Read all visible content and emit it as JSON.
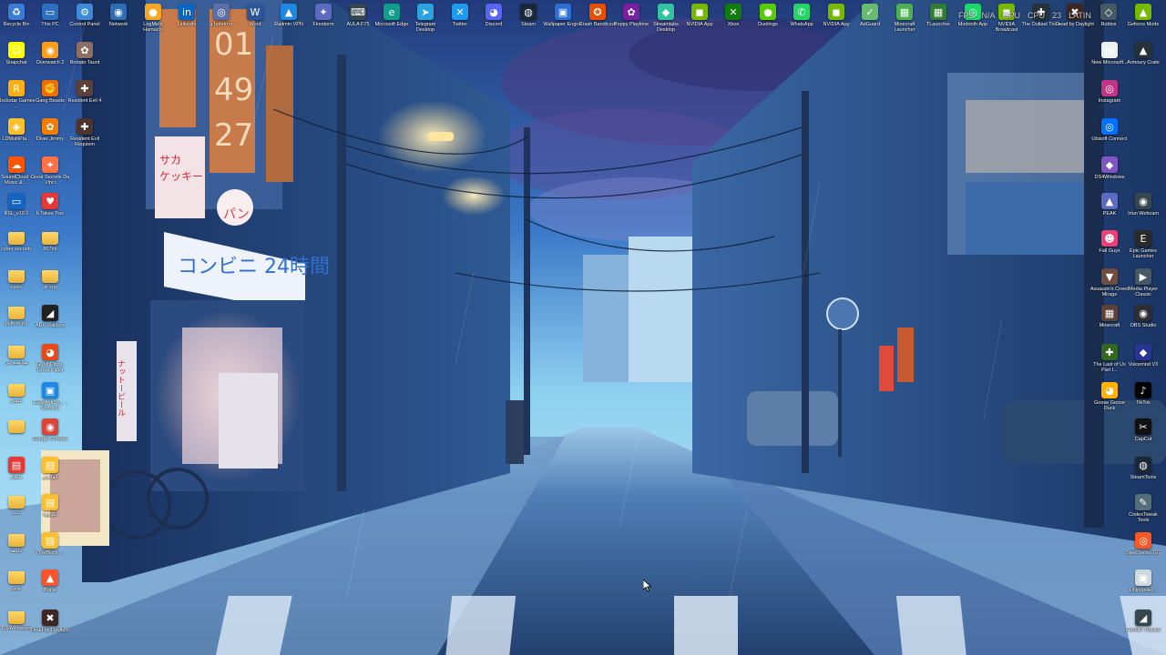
{
  "overlay": {
    "fps": "FPS",
    "gpu": "N/A",
    "gpu_label": "GPU",
    "cpu_label": "CPU",
    "cpu_value": "23",
    "brand": "LATIN"
  },
  "wallpaper": {
    "window_digits": [
      "01",
      "49",
      "27"
    ],
    "store_sign_katakana": "サカ ケッキー",
    "store_sign_main": "コンビニ 24時間",
    "store_sign_pan": "パン",
    "vertical_banner": "ナットーピール"
  },
  "colors": {
    "sky": "#1b3a78",
    "street": "#3c5f95",
    "lamp": "#ffd98a"
  },
  "icons": [
    {
      "name": "recycle-bin",
      "label": "Recycle Bin",
      "glyph": "♻",
      "color": "#3a7bd5",
      "folder": false
    },
    {
      "name": "this-pc",
      "label": "This PC",
      "glyph": "▭",
      "color": "#2f6fbf",
      "folder": false
    },
    {
      "name": "control-panel",
      "label": "Control Panel",
      "glyph": "⚙",
      "color": "#3f8ad8",
      "folder": false
    },
    {
      "name": "network",
      "label": "Network",
      "glyph": "◉",
      "color": "#2e6db3",
      "folder": false
    },
    {
      "name": "logmein-hamachi",
      "label": "LogMeIn Hamachi",
      "glyph": "●",
      "color": "#f5a623",
      "folder": false
    },
    {
      "name": "linkedin",
      "label": "LinkedIn",
      "glyph": "in",
      "color": "#0a66c2",
      "folder": false
    },
    {
      "name": "gdphorror",
      "label": "g.hohorror",
      "glyph": "◎",
      "color": "#5b6ea8",
      "folder": false
    },
    {
      "name": "word",
      "label": "Word",
      "glyph": "W",
      "color": "#2b579a",
      "folder": false
    },
    {
      "name": "radmin-vpn",
      "label": "Radmin VPN",
      "glyph": "▲",
      "color": "#1e88e5",
      "folder": false
    },
    {
      "name": "firestorm",
      "label": "Firestorm",
      "glyph": "✦",
      "color": "#5c6bc0",
      "folder": false
    },
    {
      "name": "aula-f75",
      "label": "AULA F75",
      "glyph": "⌨",
      "color": "#37474f",
      "folder": false
    },
    {
      "name": "microsoft-edge",
      "label": "Microsoft Edge",
      "glyph": "e",
      "color": "#0f9d8c",
      "folder": false
    },
    {
      "name": "telegram-desktop",
      "label": "Telegram Desktop",
      "glyph": "➤",
      "color": "#2aa3df",
      "folder": false
    },
    {
      "name": "twitter",
      "label": "Twitter",
      "glyph": "✕",
      "color": "#1d9bf0",
      "folder": false
    },
    {
      "name": "discord",
      "label": "Discord",
      "glyph": "◕",
      "color": "#5865f2",
      "folder": false
    },
    {
      "name": "steam",
      "label": "Steam",
      "glyph": "◍",
      "color": "#1b2838",
      "folder": false
    },
    {
      "name": "wallpaper-engine",
      "label": "Wallpaper Engine",
      "glyph": "▣",
      "color": "#2c6fd6",
      "folder": false
    },
    {
      "name": "crash-bandicoot",
      "label": "Crash Bandicoot",
      "glyph": "✪",
      "color": "#e65100",
      "folder": false
    },
    {
      "name": "poppy-playtime",
      "label": "Poppy Playtime",
      "glyph": "✿",
      "color": "#7b1fa2",
      "folder": false
    },
    {
      "name": "streamlabs-desktop",
      "label": "Streamlabs Desktop",
      "glyph": "◆",
      "color": "#31c3a2",
      "folder": false
    },
    {
      "name": "nvidia-app",
      "label": "NVIDIA App",
      "glyph": "◼",
      "color": "#76b900",
      "folder": false
    },
    {
      "name": "xbox",
      "label": "Xbox",
      "glyph": "✕",
      "color": "#107c10",
      "folder": false
    },
    {
      "name": "duolingo",
      "label": "Duolingo",
      "glyph": "●",
      "color": "#58cc02",
      "folder": false
    },
    {
      "name": "whatsapp",
      "label": "WhatsApp",
      "glyph": "✆",
      "color": "#25d366",
      "folder": false
    },
    {
      "name": "nvidia-app-2",
      "label": "NVIDIA App",
      "glyph": "◼",
      "color": "#76b900",
      "folder": false
    },
    {
      "name": "adguard",
      "label": "AdGuard",
      "glyph": "✓",
      "color": "#68bc71",
      "folder": false
    },
    {
      "name": "minecraft-launcher",
      "label": "Minecraft Launcher",
      "glyph": "▦",
      "color": "#4caf50",
      "folder": false
    },
    {
      "name": "tlauncher",
      "label": "TLauncher",
      "glyph": "▦",
      "color": "#2e7d32",
      "folder": false
    },
    {
      "name": "modrinth-app",
      "label": "Modrinth App",
      "glyph": "◎",
      "color": "#1bd96a",
      "folder": false
    },
    {
      "name": "nvidia-broadcast",
      "label": "NVIDIA Broadcast",
      "glyph": "◼",
      "color": "#76b900",
      "folder": false
    },
    {
      "name": "the-outlast-trials",
      "label": "The Outlast Trials",
      "glyph": "✚",
      "color": "#263238",
      "folder": false
    },
    {
      "name": "dead-by-daylight-top",
      "label": "Dead by Daylight",
      "glyph": "✖",
      "color": "#3e2723",
      "folder": false
    },
    {
      "name": "roblox",
      "label": "Roblox",
      "glyph": "◇",
      "color": "#455a64",
      "folder": false
    },
    {
      "name": "geforce-mode",
      "label": "Geforce Mode",
      "glyph": "▲",
      "color": "#76b900",
      "folder": false
    },
    {
      "name": "snapchat",
      "label": "Snapchat",
      "glyph": "☺",
      "color": "#fffc00",
      "folder": false
    },
    {
      "name": "overwatch-2",
      "label": "Overwatch 2",
      "glyph": "◉",
      "color": "#f99e1a",
      "folder": false
    },
    {
      "name": "brotato",
      "label": "Brotato Taunt",
      "glyph": "✿",
      "color": "#8d6e63",
      "folder": false
    },
    {
      "name": "rockstar-games",
      "label": "Rockstar Games ...",
      "glyph": "R",
      "color": "#fcaf17",
      "folder": false
    },
    {
      "name": "gang-beasts",
      "label": "Gang Beasts",
      "glyph": "✊",
      "color": "#ef6c00",
      "folder": false
    },
    {
      "name": "resident-evil-4",
      "label": "Resident Evil 4",
      "glyph": "✚",
      "color": "#5d4037",
      "folder": false
    },
    {
      "name": "ldmultiplayer",
      "label": "LDMultiPla...",
      "glyph": "◈",
      "color": "#fbc02d",
      "folder": false
    },
    {
      "name": "diver-jimmy",
      "label": "Diver Jimmy",
      "glyph": "✿",
      "color": "#f57c00",
      "folder": false
    },
    {
      "name": "resident-evil-requiem",
      "label": "Resident Evil Requiem",
      "glyph": "✚",
      "color": "#4e342e",
      "folder": false
    },
    {
      "name": "soundcloud",
      "label": "SoundCloud - Music & ...",
      "glyph": "☁",
      "color": "#ff5500",
      "folder": false
    },
    {
      "name": "great-secrets",
      "label": "Great Secrets Da Vinci",
      "glyph": "✦",
      "color": "#ff7043",
      "folder": false
    },
    {
      "name": "bsl",
      "label": "BSL_v10.0",
      "glyph": "▭",
      "color": "#1565c0",
      "folder": false
    },
    {
      "name": "it-takes-two",
      "label": "It Takes Two",
      "glyph": "♥",
      "color": "#e53935",
      "folder": false
    },
    {
      "name": "cyber-security",
      "label": "cyber security",
      "glyph": "",
      "color": "#e8b23a",
      "folder": true
    },
    {
      "name": "folder-867hb",
      "label": "867hb",
      "glyph": "",
      "color": "#e8b23a",
      "folder": true
    },
    {
      "name": "folder-episo",
      "label": "episo",
      "glyph": "",
      "color": "#e8b23a",
      "folder": true
    },
    {
      "name": "folder-allsog",
      "label": "all sog",
      "glyph": "",
      "color": "#e8b23a",
      "folder": true
    },
    {
      "name": "python-try",
      "label": "python try",
      "glyph": "",
      "color": "#e8b23a",
      "folder": true
    },
    {
      "name": "arc-raiders",
      "label": "ARC Raiders",
      "glyph": "◢",
      "color": "#212121",
      "folder": false
    },
    {
      "name": "folder-arabic-1",
      "label": "مواضيع ابي",
      "glyph": "",
      "color": "#e8b23a",
      "folder": true
    },
    {
      "name": "good-pizza",
      "label": "Good Pizza, Great Pizza",
      "glyph": "◕",
      "color": "#e64a19",
      "folder": false
    },
    {
      "name": "folder-arabic-2",
      "label": "علوان",
      "glyph": "",
      "color": "#e8b23a",
      "folder": true
    },
    {
      "name": "easyantichaet",
      "label": "EasyAntiCh... - Shortcut",
      "glyph": "▣",
      "color": "#1e88e5",
      "folder": false
    },
    {
      "name": "folder-blank",
      "label": "",
      "glyph": "",
      "color": "#e8b23a",
      "folder": true
    },
    {
      "name": "google-chrome",
      "label": "Google Chrome",
      "glyph": "◉",
      "color": "#db4437",
      "folder": false
    },
    {
      "name": "arabic-file-1",
      "label": "دانيال",
      "glyph": "▤",
      "color": "#e53935",
      "folder": false
    },
    {
      "name": "file-alfaris",
      "label": "الفارس",
      "glyph": "▤",
      "color": "#fbc02d",
      "folder": false
    },
    {
      "name": "folder-arabic-3",
      "label": "كتب",
      "glyph": "",
      "color": "#e8b23a",
      "folder": true
    },
    {
      "name": "file-albroza",
      "label": "البروزة",
      "glyph": "▤",
      "color": "#fbc02d",
      "folder": false
    },
    {
      "name": "folder-arabic-4",
      "label": "جامعة",
      "glyph": "",
      "color": "#e8b23a",
      "folder": true
    },
    {
      "name": "onedrive-shortcut",
      "label": "OneBlock ...",
      "glyph": "▤",
      "color": "#fbc02d",
      "folder": false
    },
    {
      "name": "folder-arabic-5",
      "label": "تويتر",
      "glyph": "",
      "color": "#e8b23a",
      "folder": true
    },
    {
      "name": "brave",
      "label": "Brave",
      "glyph": "▲",
      "color": "#fb542b",
      "folder": false
    },
    {
      "name": "ds4windows-left",
      "label": "DS4Windows",
      "glyph": "",
      "color": "#e8b23a",
      "folder": true
    },
    {
      "name": "dead-by-daylight-left",
      "label": "Dead by Daylight",
      "glyph": "✖",
      "color": "#3e2723",
      "folder": false
    },
    {
      "name": "new-microsoft",
      "label": "New Microsoft...",
      "glyph": "▤",
      "color": "#eceff1",
      "folder": false
    },
    {
      "name": "armoury-crate",
      "label": "Armoury Crate",
      "glyph": "▲",
      "color": "#263238",
      "folder": false
    },
    {
      "name": "instagram",
      "label": "Instagram",
      "glyph": "◎",
      "color": "#c13584",
      "folder": false
    },
    {
      "name": "ubisoft-connect",
      "label": "Ubisoft Connect",
      "glyph": "◎",
      "color": "#0070ff",
      "folder": false
    },
    {
      "name": "ds4windows-right",
      "label": "DS4Windows",
      "glyph": "◆",
      "color": "#7e57c2",
      "folder": false
    },
    {
      "name": "peak",
      "label": "PEAK",
      "glyph": "▲",
      "color": "#5c6bc0",
      "folder": false
    },
    {
      "name": "iriun-webcam",
      "label": "Iriun Webcam",
      "glyph": "◉",
      "color": "#37474f",
      "folder": false
    },
    {
      "name": "fall-guys",
      "label": "Fall Guys",
      "glyph": "☻",
      "color": "#ec407a",
      "folder": false
    },
    {
      "name": "epic-games",
      "label": "Epic Games Launcher",
      "glyph": "E",
      "color": "#2a2a2a",
      "folder": false
    },
    {
      "name": "assassins-creed",
      "label": "Assassin's Creed Mirage",
      "glyph": "▼",
      "color": "#6d4c41",
      "folder": false
    },
    {
      "name": "media-player",
      "label": "Media Player Classic",
      "glyph": "▶",
      "color": "#455a64",
      "folder": false
    },
    {
      "name": "minecraft",
      "label": "Minecraft",
      "glyph": "▦",
      "color": "#5d4037",
      "folder": false
    },
    {
      "name": "obs-studio",
      "label": "OBS Studio",
      "glyph": "◉",
      "color": "#302e31",
      "folder": false
    },
    {
      "name": "the-last-of-us",
      "label": "The Last of Us Part I...",
      "glyph": "✚",
      "color": "#33691e",
      "folder": false
    },
    {
      "name": "voicemod",
      "label": "Voicemod V3",
      "glyph": "◆",
      "color": "#283593",
      "folder": false
    },
    {
      "name": "goose-goose-duck",
      "label": "Goose Goose Duck",
      "glyph": "◕",
      "color": "#ffb300",
      "folder": false
    },
    {
      "name": "tiktok",
      "label": "TikTok",
      "glyph": "♪",
      "color": "#010101",
      "folder": false
    },
    {
      "name": "capcut",
      "label": "CapCut",
      "glyph": "✂",
      "color": "#111111",
      "folder": false
    },
    {
      "name": "steamtools",
      "label": "SteamTools",
      "glyph": "◍",
      "color": "#1b2838",
      "folder": false
    },
    {
      "name": "codex-tweak",
      "label": "CodexTweak Tools",
      "glyph": "✎",
      "color": "#546e7a",
      "folder": false
    },
    {
      "name": "steelseries-gg",
      "label": "SteelSeries GG",
      "glyph": "◎",
      "color": "#ff5722",
      "folder": false
    },
    {
      "name": "uninstaller",
      "label": "Uninstaller...",
      "glyph": "▣",
      "color": "#cfd8dc",
      "folder": false
    },
    {
      "name": "fortnite-tracker",
      "label": "Fortnite Tracker",
      "glyph": "◢",
      "color": "#37474f",
      "folder": false
    }
  ]
}
